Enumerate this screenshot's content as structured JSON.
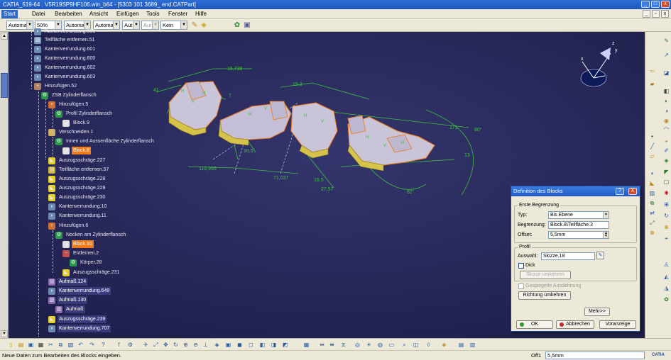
{
  "window": {
    "title": "CATIA_519-64 . V5R19SP9HF106.win_b64 - [5303 101 3689_ end.CATPart]"
  },
  "menu": {
    "items": [
      "Start",
      "Datei",
      "Bearbeiten",
      "Ansicht",
      "Einfügen",
      "Tools",
      "Fenster",
      "Hilfe"
    ]
  },
  "toolbar": {
    "combo1": "Automa",
    "combo2": "50%",
    "combo3": "Automa",
    "combo4": "Automa",
    "combo5": "Aut",
    "combo6": "Aut",
    "combo7": "Kein"
  },
  "tree": {
    "nodes": [
      "Kantenverrundung.601",
      "Teilfläche entfernen.51",
      "Kantenverrundung.601",
      "Kantenverrundung.600",
      "Kantenverrundung.602",
      "Kantenverrundung.603",
      "Hinzufügen.52",
      "ZSB Zylinderflansch",
      "Hinzufügen.5",
      "Profil Zylinderflansch",
      "Block.9",
      "Verschneiden.1",
      "Innen und Aussenfläche Zylinderflansch",
      "Block.8",
      "Auszugsschräge.227",
      "Teilfläche entfernen.57",
      "Auszugsschräge.228",
      "Auszugsschräge.229",
      "Auszugsschräge.230",
      "Kantenverrundung.10",
      "Kantenverrundung.11",
      "Hinzufügen.6",
      "Nocken am Zylinderflansch",
      "Block.10",
      "Entfernen.2",
      "Körper.28",
      "Auszugsschräge.231",
      "Aufmaß.124",
      "Kantenverrundung.649",
      "Aufmaß.130",
      "Aufmaß",
      "Auszugsschräge.239",
      "Kantenverrundung.707"
    ]
  },
  "dimensions": {
    "d1": "16,736",
    "d2": "41",
    "d3": "19,3",
    "d4": "171",
    "d5": "80°",
    "d6": "110,995",
    "d7": "71,037",
    "d8": "16,5",
    "d9": "27,57",
    "d10": "16,5",
    "d11": "13",
    "d12": "82°",
    "d13": "7"
  },
  "compass": {
    "x": "x",
    "y": "y",
    "z": "z"
  },
  "dialog": {
    "title": "Definition des Blocks",
    "help": "?",
    "close": "X",
    "group1": "Erste Begrenzung",
    "typ_label": "Typ:",
    "typ_value": "Bis Ebene",
    "begrenzung_label": "Begrenzung:",
    "begrenzung_value": "Block.8\\Teilfläche.3",
    "offset_label": "Offset:",
    "offset_value": "5,5mm",
    "group2": "Profil",
    "auswahl_label": "Auswahl:",
    "auswahl_value": "Skizze.18",
    "dick_label": "Dick",
    "skizze_btn": "Skizze umkehren",
    "gespiegelt_label": "Gespiegelte Ausdehnung",
    "richtung_btn": "Richtung umkehren",
    "mehr_btn": "Mehr>>",
    "ok_btn": "OK",
    "abbrechen_btn": "Abbrechen",
    "vorschau_btn": "Voranzeige"
  },
  "status": {
    "message": "Neue Daten zum Bearbeiten des Blocks eingeben.",
    "offset_label": "Off1",
    "offset_value": "5,5mm",
    "logo": "CATIA"
  },
  "colors": {
    "viewport_bg": "#27285a",
    "tree_text": "#e8e8f4",
    "selected": "#f07a18",
    "dimension_green": "#3ec23e",
    "part_face": "#c9c4d8",
    "part_edge_yellow": "#e8d24a"
  }
}
